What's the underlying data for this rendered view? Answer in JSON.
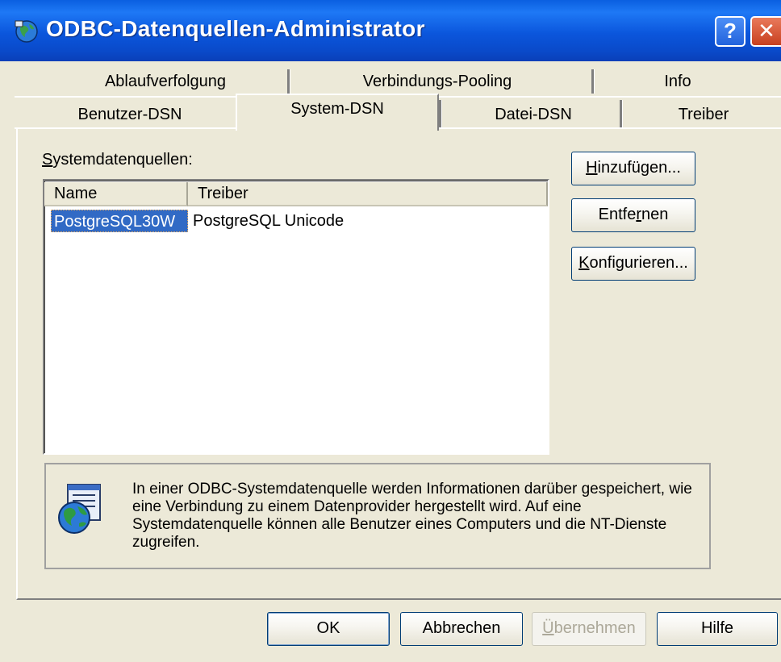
{
  "window": {
    "title": "ODBC-Datenquellen-Administrator",
    "help_glyph": "?",
    "close_glyph": "✕"
  },
  "tabs": {
    "row_back": [
      {
        "id": "ablaufverfolgung",
        "label": "Ablaufverfolgung"
      },
      {
        "id": "verbindungs-pooling",
        "label": "Verbindungs-Pooling"
      },
      {
        "id": "info",
        "label": "Info"
      }
    ],
    "row_front": [
      {
        "id": "benutzer-dsn",
        "label": "Benutzer-DSN"
      },
      {
        "id": "system-dsn",
        "label": "System-DSN",
        "selected": true
      },
      {
        "id": "datei-dsn",
        "label": "Datei-DSN"
      },
      {
        "id": "treiber",
        "label": "Treiber"
      }
    ]
  },
  "systemdatenquellen": {
    "label_mnemonic": "S",
    "label_rest": "ystemdatenquellen:",
    "columns": [
      "Name",
      "Treiber"
    ],
    "rows": [
      {
        "name": "PostgreSQL30W",
        "driver": "PostgreSQL Unicode",
        "selected": true
      }
    ]
  },
  "side_buttons": {
    "add": {
      "mnemonic": "H",
      "rest": "inzufügen..."
    },
    "remove": {
      "pre": "Entfe",
      "mnemonic": "r",
      "rest": "nen"
    },
    "configure": {
      "mnemonic": "K",
      "rest": "onfigurieren..."
    }
  },
  "info_text": "In einer ODBC-Systemdatenquelle werden Informationen darüber gespeichert, wie eine Verbindung zu einem Datenprovider hergestellt wird. Auf eine Systemdatenquelle können alle Benutzer eines Computers und die NT-Dienste  zugreifen.",
  "footer_buttons": {
    "ok": "OK",
    "cancel": "Abbrechen",
    "apply": {
      "mnemonic": "Ü",
      "rest": "bernehmen",
      "disabled": true
    },
    "help": "Hilfe"
  },
  "colors": {
    "titlebar": "#0a56dc",
    "selection": "#316ac5",
    "dialog_bg": "#ece9d8"
  },
  "icons": {
    "app": "odbc-globe-icon",
    "info": "database-globe-icon"
  }
}
